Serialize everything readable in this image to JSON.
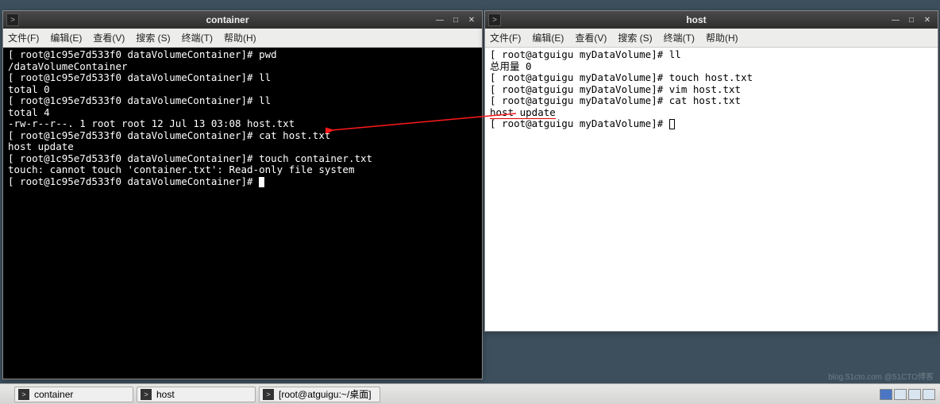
{
  "windows": {
    "container": {
      "title": "container",
      "menus": [
        "文件(F)",
        "编辑(E)",
        "查看(V)",
        "搜索 (S)",
        "终端(T)",
        "帮助(H)"
      ],
      "lines": [
        "[ root@1c95e7d533f0 dataVolumeContainer]# pwd",
        "/dataVolumeContainer",
        "[ root@1c95e7d533f0 dataVolumeContainer]# ll",
        "total 0",
        "[ root@1c95e7d533f0 dataVolumeContainer]# ll",
        "total 4",
        "-rw-r--r--. 1 root root 12 Jul 13 03:08 host.txt",
        "[ root@1c95e7d533f0 dataVolumeContainer]# cat host.txt",
        "host update",
        "[ root@1c95e7d533f0 dataVolumeContainer]# touch container.txt",
        "touch: cannot touch 'container.txt': Read-only file system",
        "[ root@1c95e7d533f0 dataVolumeContainer]# "
      ]
    },
    "host": {
      "title": "host",
      "menus": [
        "文件(F)",
        "编辑(E)",
        "查看(V)",
        "搜索 (S)",
        "终端(T)",
        "帮助(H)"
      ],
      "lines": [
        "[ root@atguigu myDataVolume]# ll",
        "总用量 0",
        "[ root@atguigu myDataVolume]# touch host.txt",
        "[ root@atguigu myDataVolume]# vim host.txt",
        "[ root@atguigu myDataVolume]# cat host.txt",
        "host update",
        "[ root@atguigu myDataVolume]# "
      ],
      "underline_line_index": 5
    }
  },
  "taskbar": {
    "items": [
      {
        "icon": ">",
        "label": "container"
      },
      {
        "icon": ">",
        "label": "host"
      },
      {
        "icon": ">",
        "label": "[root@atguigu:~/桌面]"
      }
    ]
  },
  "watermark": "blog.51cto.com @51CTO博客"
}
